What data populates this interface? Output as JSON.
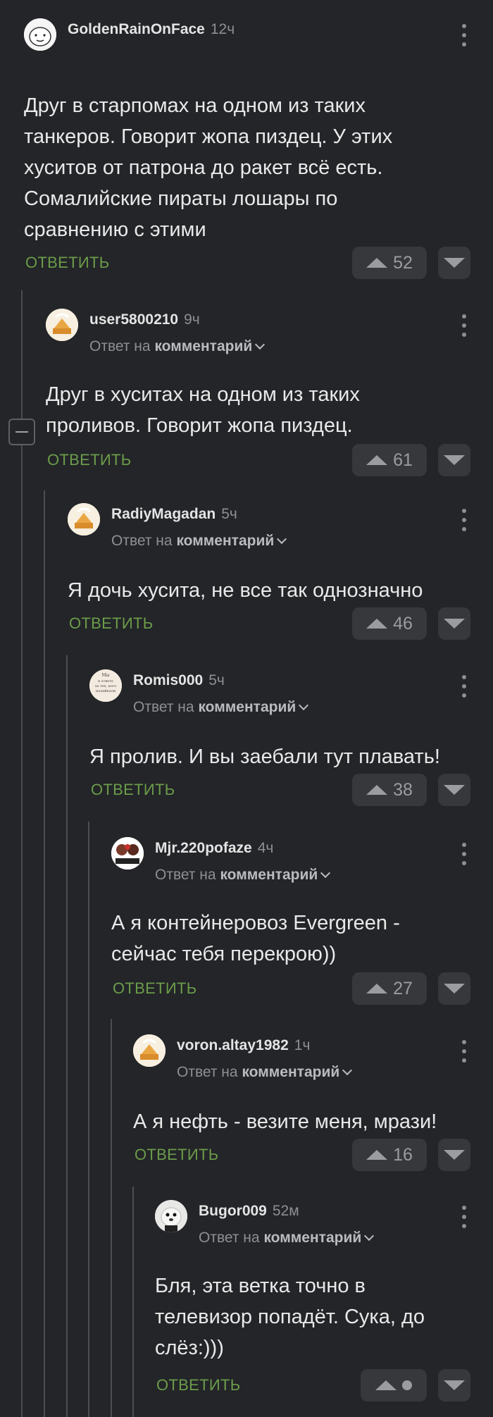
{
  "comments": [
    {
      "author": "GoldenRainOnFace",
      "time": "12ч",
      "reply_prefix": "",
      "reply_target": "",
      "text": [
        "Друг в старпомах на одном из таких",
        "танкеров. Говорит жопа пиздец. У этих",
        "хуситов от патрона до ракет всё есть.",
        "Сомалийские пираты лошары по",
        "сравнению с этими"
      ],
      "reply_label": "ОТВЕТИТЬ",
      "rating": "52"
    },
    {
      "author": "user5800210",
      "time": "9ч",
      "reply_prefix": "Ответ на",
      "reply_target": "комментарий",
      "text": [
        "Друг в хуситах на одном из таких",
        "проливов. Говорит жопа пиздец."
      ],
      "reply_label": "ОТВЕТИТЬ",
      "rating": "61"
    },
    {
      "author": "RadiyMagadan",
      "time": "5ч",
      "reply_prefix": "Ответ на",
      "reply_target": "комментарий",
      "text": [
        "Я дочь хусита, не все так однозначно"
      ],
      "reply_label": "ОТВЕТИТЬ",
      "rating": "46"
    },
    {
      "author": "Romis000",
      "time": "5ч",
      "reply_prefix": "Ответ на",
      "reply_target": "комментарий",
      "text": [
        "Я пролив. И вы заебали тут плавать!"
      ],
      "reply_label": "ОТВЕТИТЬ",
      "rating": "38"
    },
    {
      "author": "Mjr.220pofaze",
      "time": "4ч",
      "reply_prefix": "Ответ на",
      "reply_target": "комментарий",
      "text": [
        "А я контейнеровоз Evergreen -",
        "сейчас тебя перекрою))"
      ],
      "reply_label": "ОТВЕТИТЬ",
      "rating": "27"
    },
    {
      "author": "voron.altay1982",
      "time": "1ч",
      "reply_prefix": "Ответ на",
      "reply_target": "комментарий",
      "text": [
        "А я нефть - везите меня, мрази!"
      ],
      "reply_label": "ОТВЕТИТЬ",
      "rating": "16"
    },
    {
      "author": "Bugor009",
      "time": "52м",
      "reply_prefix": "Ответ на",
      "reply_target": "комментарий",
      "text": [
        "Бля, эта ветка точно в",
        "телевизор попадёт. Сука, до",
        "слёз:)))"
      ],
      "reply_label": "ОТВЕТИТЬ",
      "rating": ""
    }
  ],
  "avatar_text": [
    "Мы",
    "в ответе",
    "за тех, кого",
    "налайкали"
  ],
  "colors": {
    "background": "#232528",
    "reply_link": "#6b9c4a",
    "muted": "#8d8f94",
    "vote_bg": "#36383c"
  }
}
